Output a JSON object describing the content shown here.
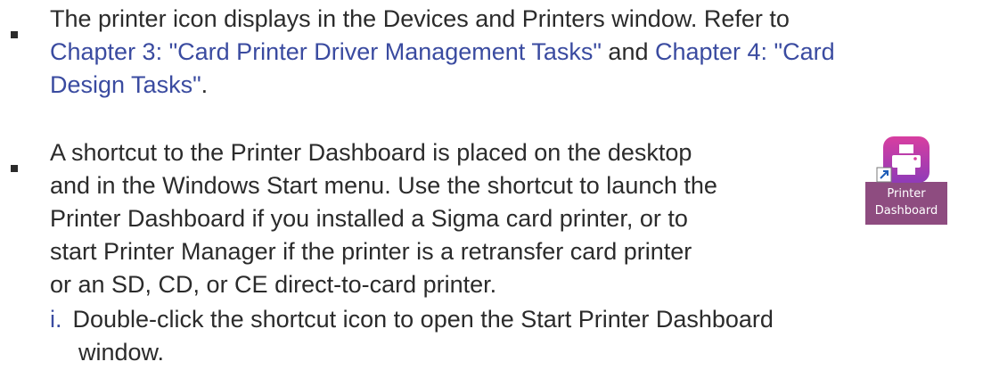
{
  "bullet1": {
    "text_before": "The printer icon displays in the Devices and Printers window. Refer to",
    "link1": "Chapter 3: \"Card Printer Driver Management Tasks\"",
    "and": " and ",
    "link2": "Chapter 4: \"Card",
    "link2_line2": "Design Tasks\"",
    "text_after": "."
  },
  "bullet2": {
    "lines": [
      "A shortcut to the Printer Dashboard is placed on the desktop",
      "and in the Windows Start menu. Use the shortcut to launch the",
      "Printer Dashboard if you installed a Sigma card printer, or to",
      "start Printer Manager if the printer is a retransfer card printer",
      "or an SD, CD, or CE direct-to-card printer."
    ]
  },
  "desktop_icon": {
    "name": "printer-dashboard-shortcut-icon",
    "label_line1": "Printer",
    "label_line2": "Dashboard",
    "gradient_top": "#d83ea0",
    "gradient_bottom": "#8f3bb8"
  },
  "step": {
    "marker": "i.",
    "line1": "Double-click the shortcut icon to open the Start Printer Dashboard",
    "line2": "window."
  },
  "colors": {
    "link": "#3a4ba0",
    "text": "#2b2b2b"
  }
}
